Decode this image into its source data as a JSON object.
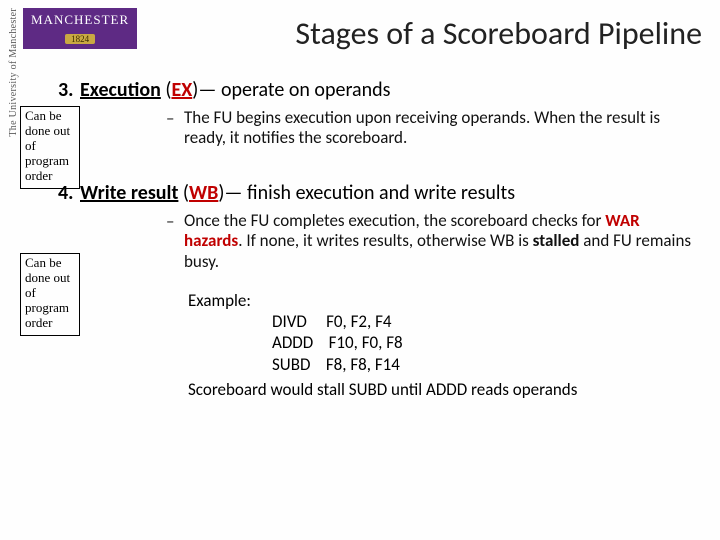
{
  "logo": {
    "sideText": "The University of Manchester",
    "main": "MANCHESTER",
    "year": "1824"
  },
  "title": "Stages of a Scoreboard Pipeline",
  "sideNote": "Can be done out of program order",
  "stage3": {
    "num": "3.",
    "name": "Execution",
    "abbr": "EX",
    "rest": "— operate on operands",
    "bullet": "The FU begins execution upon receiving operands. When the result is ready, it notifies the scoreboard."
  },
  "stage4": {
    "num": "4.",
    "name": "Write result",
    "abbr": "WB",
    "rest": "— finish execution and write results",
    "bulletPre": "Once the FU completes execution, the scoreboard checks for ",
    "war": "WAR hazards",
    "bulletMid": ".  If none, it writes results, otherwise WB is ",
    "stalled": "stalled",
    "bulletPost": " and FU remains busy."
  },
  "example": {
    "label": "Example:",
    "i1op": "DIVD",
    "i1args": "F0, F2, F4",
    "i2op": "ADDD",
    "i2args": "F10, F0, F8",
    "i3op": "SUBD",
    "i3args": "F8, F8, F14",
    "conclusion": "Scoreboard would stall SUBD until ADDD reads operands"
  }
}
